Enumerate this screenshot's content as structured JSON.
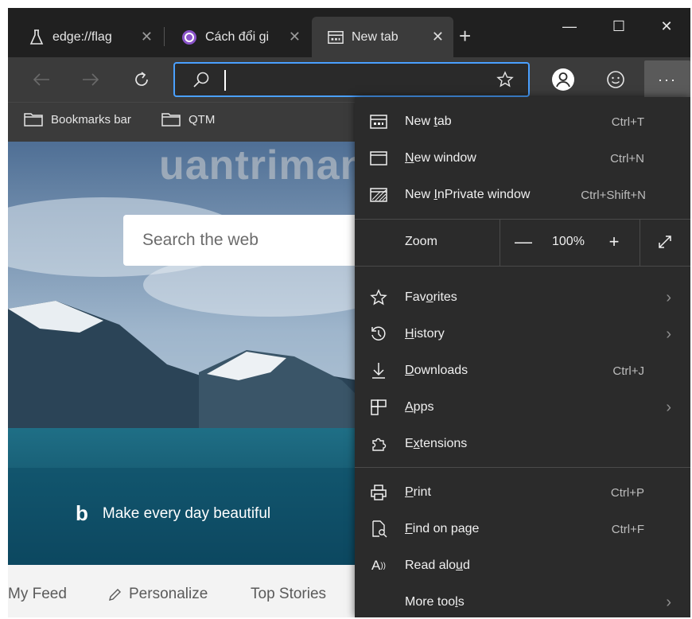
{
  "tabs": [
    {
      "title": "edge://flag",
      "icon": "flask-icon"
    },
    {
      "title": "Cách đổi gi",
      "icon": "site-favicon-icon"
    },
    {
      "title": "New tab",
      "icon": "newtab-icon",
      "active": true
    }
  ],
  "window": {
    "minimize": "—",
    "maximize": "☐",
    "close": "✕"
  },
  "address": {
    "value": "",
    "placeholder": ""
  },
  "bookmarks": [
    {
      "label": "Bookmarks bar"
    },
    {
      "label": "QTM"
    }
  ],
  "watermark": "uantrimang",
  "newtab": {
    "search_placeholder": "Search the web",
    "bing_caption": "Make every day beautiful",
    "feed": [
      "My Feed",
      "Personalize",
      "Top Stories"
    ]
  },
  "menu": {
    "new_tab": {
      "pre": "New ",
      "key": "t",
      "post": "ab",
      "shortcut": "Ctrl+T"
    },
    "new_window": {
      "pre": "",
      "key": "N",
      "post": "ew window",
      "shortcut": "Ctrl+N"
    },
    "new_inprivate": {
      "pre": "New ",
      "key": "I",
      "post": "nPrivate window",
      "shortcut": "Ctrl+Shift+N"
    },
    "zoom": {
      "label": "Zoom",
      "minus": "—",
      "value": "100%",
      "plus": "+"
    },
    "favorites": {
      "pre": "Fav",
      "key": "o",
      "post": "rites"
    },
    "history": {
      "pre": "",
      "key": "H",
      "post": "istory"
    },
    "downloads": {
      "pre": "",
      "key": "D",
      "post": "ownloads",
      "shortcut": "Ctrl+J"
    },
    "apps": {
      "pre": "",
      "key": "A",
      "post": "pps"
    },
    "extensions": {
      "pre": "E",
      "key": "x",
      "post": "tensions"
    },
    "print": {
      "pre": "",
      "key": "P",
      "post": "rint",
      "shortcut": "Ctrl+P"
    },
    "find": {
      "pre": "",
      "key": "F",
      "post": "ind on page",
      "shortcut": "Ctrl+F"
    },
    "read_aloud": {
      "pre": "Read alo",
      "key": "u",
      "post": "d"
    },
    "more_tools": {
      "pre": "More too",
      "key": "l",
      "post": "s"
    }
  },
  "colors": {
    "accent": "#4aa0ff",
    "menu_bg": "#2b2b2b",
    "toolbar_bg": "#3b3b3b"
  }
}
